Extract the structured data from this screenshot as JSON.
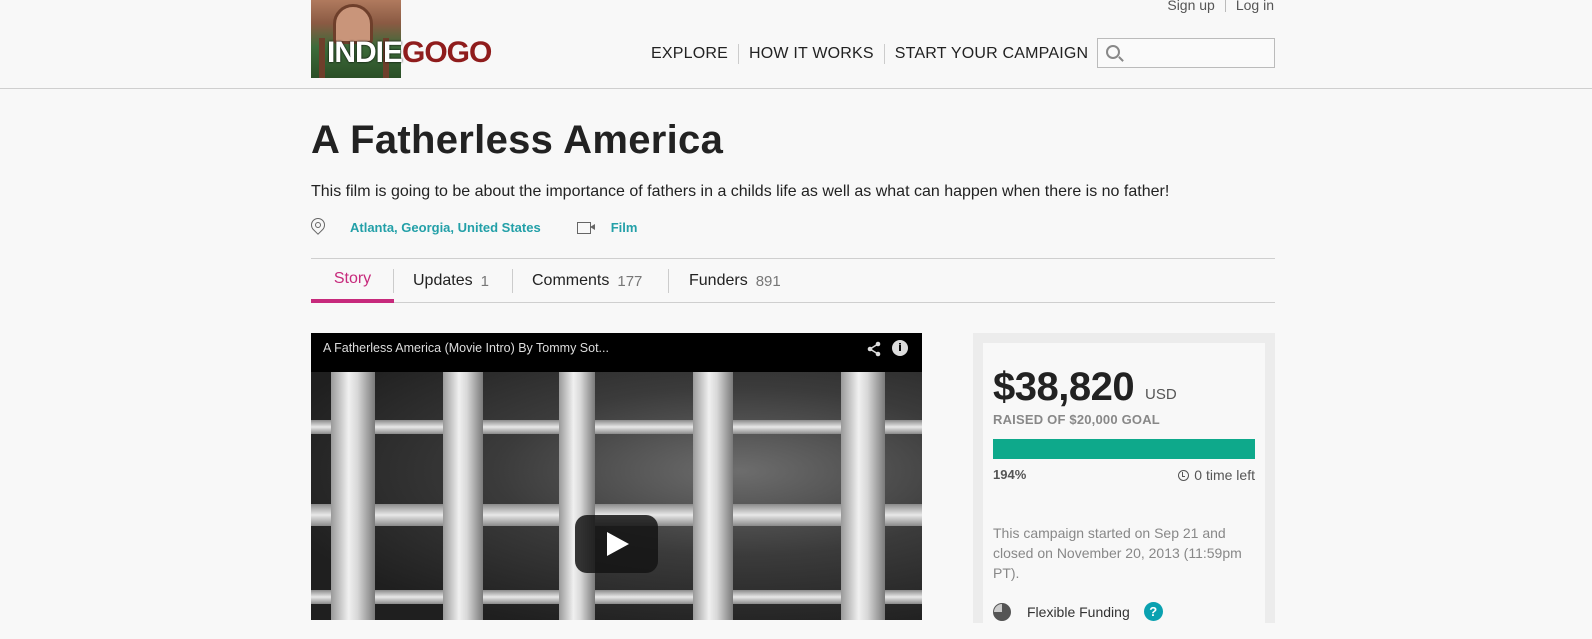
{
  "header": {
    "logo": {
      "text_part1": "INDIE",
      "text_part2": "GOGO"
    },
    "top_links": {
      "signup": "Sign up",
      "login": "Log in"
    },
    "nav": [
      {
        "label": "EXPLORE"
      },
      {
        "label": "HOW IT WORKS"
      },
      {
        "label": "START YOUR CAMPAIGN"
      }
    ],
    "search": {
      "placeholder": "",
      "value": ""
    }
  },
  "campaign": {
    "title": "A Fatherless America",
    "tagline": "This film is going to be about the importance of fathers in a childs life as well as what can happen when there is no father!",
    "location": "Atlanta, Georgia, United States",
    "category": "Film"
  },
  "tabs": [
    {
      "label": "Story",
      "count": "",
      "active": true
    },
    {
      "label": "Updates",
      "count": "1",
      "active": false
    },
    {
      "label": "Comments",
      "count": "177",
      "active": false
    },
    {
      "label": "Funders",
      "count": "891",
      "active": false
    }
  ],
  "video": {
    "title": "A Fatherless America (Movie Intro) By Tommy Sot..."
  },
  "funding": {
    "amount": "$38,820",
    "currency": "USD",
    "goal_text": "RAISED OF $20,000 GOAL",
    "percent_label": "194%",
    "progress_fraction": 1.0,
    "time_left": "0 time left",
    "started_text": "This campaign started on Sep 21 and closed on November 20, 2013 (11:59pm PT).",
    "funding_type": "Flexible Funding",
    "help_symbol": "?",
    "accent_color": "#0ea98b"
  },
  "colors": {
    "tab_active": "#c72a7c",
    "link_teal": "#23a0a8",
    "brand_red": "#8f1c1c"
  }
}
